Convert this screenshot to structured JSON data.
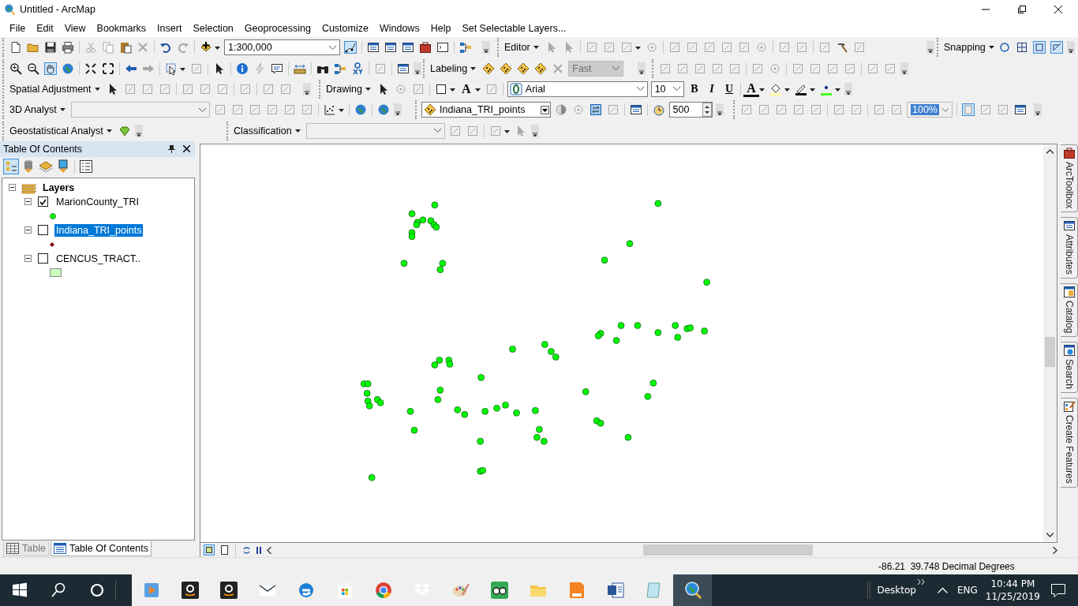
{
  "window": {
    "title": "Untitled - ArcMap"
  },
  "menu_bar": [
    "File",
    "Edit",
    "View",
    "Bookmarks",
    "Insert",
    "Selection",
    "Geoprocessing",
    "Customize",
    "Windows",
    "Help",
    "Set Selectable Layers..."
  ],
  "standard_toolbar": {
    "scale": "1:300,000"
  },
  "editor_toolbar": {
    "menu": "Editor"
  },
  "snapping_toolbar": {
    "menu": "Snapping"
  },
  "labeling_toolbar": {
    "menu": "Labeling",
    "quality": "Fast"
  },
  "spatial_adjustment_toolbar": {
    "menu": "Spatial Adjustment"
  },
  "drawing_toolbar": {
    "menu": "Drawing",
    "text_button": "A",
    "font": "Arial",
    "font_size": "10",
    "bold_button": "B",
    "italic_button": "I",
    "underline_button": "U",
    "font_color_button": "A"
  },
  "analyst_3d_toolbar": {
    "menu": "3D Analyst"
  },
  "effects_toolbar": {
    "layer": "Indiana_TRI_points",
    "value": "500"
  },
  "layout_toolbar": {
    "zoom": "100%"
  },
  "geostatistical_toolbar": {
    "menu": "Geostatistical Analyst"
  },
  "classification_toolbar": {
    "menu": "Classification"
  },
  "toc": {
    "title": "Table Of Contents",
    "group": {
      "label": "Layers",
      "expanded": true
    },
    "layers": [
      {
        "label": "MarionCounty_TRI",
        "checked": true,
        "selected": false,
        "expanded": true,
        "kind": "circle",
        "color": "#00ff00"
      },
      {
        "label": "Indiana_TRI_points",
        "checked": false,
        "selected": true,
        "expanded": true,
        "kind": "diamond",
        "color": "#800000"
      },
      {
        "label": "CENCUS_TRACT..",
        "checked": false,
        "selected": false,
        "expanded": true,
        "kind": "polygon",
        "color": "#ccffbb"
      }
    ]
  },
  "bottom_tabs": [
    {
      "label": "Table",
      "selected": false
    },
    {
      "label": "Table Of Contents",
      "selected": true
    }
  ],
  "right_dock": [
    {
      "label": "ArcToolbox"
    },
    {
      "label": "Attributes"
    },
    {
      "label": "Catalog"
    },
    {
      "label": "Search"
    },
    {
      "label": "Create Features"
    }
  ],
  "status_bar": {
    "coordinates": "-86.21  39.748 Decimal Degrees"
  },
  "taskbar": {
    "desktop": "Desktop",
    "language": "ENG",
    "time": "10:44 PM",
    "date": "11/25/2019"
  }
}
